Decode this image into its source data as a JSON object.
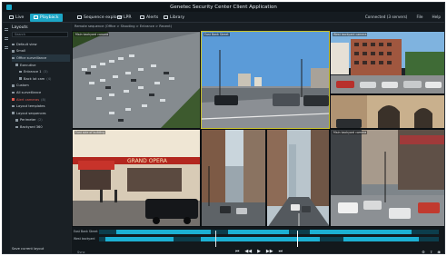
{
  "window": {
    "title": "Genetec Security Center Client Application"
  },
  "menu": {
    "tabs": [
      {
        "label": "Live",
        "icon": "monitor-icon"
      },
      {
        "label": "Playback",
        "icon": "playback-icon"
      },
      {
        "label": "Sequence explorer",
        "icon": "sequence-icon"
      },
      {
        "label": "LPR",
        "icon": "lpr-icon"
      },
      {
        "label": "Alerts",
        "icon": "bell-icon"
      },
      {
        "label": "Library",
        "icon": "library-icon"
      }
    ],
    "right": {
      "connection": "Connected (3 servers)",
      "file": "File",
      "help": "Help"
    }
  },
  "sidebar": {
    "title": "Layouts",
    "search_placeholder": "Search",
    "items": [
      {
        "label": "Default view",
        "count": ""
      },
      {
        "label": "Small",
        "count": ""
      },
      {
        "label": "Office surveillance",
        "count": ""
      },
      {
        "label": "Executive",
        "count": ""
      },
      {
        "label": "Entrance 1",
        "count": "(3)"
      },
      {
        "label": "Back lot cam",
        "count": "(4)"
      },
      {
        "label": "Custom",
        "count": ""
      },
      {
        "label": "All surveillance",
        "count": ""
      },
      {
        "label": "Alert cameras",
        "count": "(8)"
      },
      {
        "label": "Layout templates",
        "count": ""
      },
      {
        "label": "Layout sequences",
        "count": ""
      },
      {
        "label": "Perimeter",
        "count": "(2)"
      },
      {
        "label": "Backyard 360",
        "count": ""
      }
    ],
    "add_layout": "Save current layout"
  },
  "breadcrumb": "Remote sequence (Office > Shooting > Entrance > Recent)",
  "tiles": [
    {
      "caption": "Main backyard camera"
    },
    {
      "caption": "East Bank Street"
    },
    {
      "caption": "West backyard camera"
    },
    {
      "caption": ""
    },
    {
      "caption": "East side of building"
    },
    {
      "caption": ""
    },
    {
      "caption": ""
    },
    {
      "caption": "Main backyard camera"
    }
  ],
  "timeline": {
    "track_labels": [
      "East Bank Street",
      "West backyard"
    ],
    "left_text": "Sync",
    "right_icons": [
      "settings",
      "export",
      "snapshot"
    ]
  }
}
